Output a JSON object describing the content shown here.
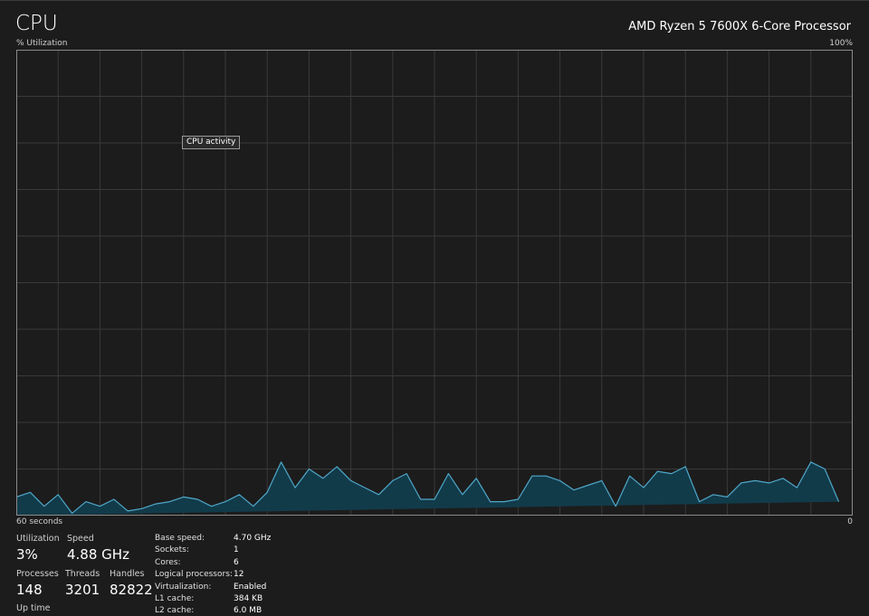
{
  "header": {
    "title": "CPU",
    "processor": "AMD Ryzen 5 7600X 6-Core Processor",
    "utilization_axis_label": "% Utilization",
    "utilization_axis_max": "100%"
  },
  "graph": {
    "time_left_label": "60 seconds",
    "time_right_label": "0",
    "tooltip": "CPU activity",
    "line_color": "#4fa7c9",
    "fill_color": "#123b4a",
    "grid_color": "#3a3a3a",
    "border_color": "#8a8a8a"
  },
  "chart_data": {
    "type": "area",
    "xlabel": "",
    "ylabel": "% Utilization",
    "ylim": [
      0,
      100
    ],
    "xlim": [
      60,
      0
    ],
    "grid": true,
    "x": [
      60,
      59,
      58,
      57,
      56,
      55,
      54,
      53,
      52,
      51,
      50,
      49,
      48,
      47,
      46,
      45,
      44,
      43,
      42,
      41,
      40,
      39,
      38,
      37,
      36,
      35,
      34,
      33,
      32,
      31,
      30,
      29,
      28,
      27,
      26,
      25,
      24,
      23,
      22,
      21,
      20,
      19,
      18,
      17,
      16,
      15,
      14,
      13,
      12,
      11,
      10,
      9,
      8,
      7,
      6,
      5,
      4,
      3,
      2,
      1,
      0
    ],
    "values": [
      4,
      5,
      2,
      4.5,
      0.5,
      3,
      2,
      3.5,
      1,
      1.5,
      2.5,
      3,
      4,
      3.5,
      2,
      3,
      4.5,
      2,
      5,
      11.5,
      6,
      10,
      8,
      10.5,
      7.5,
      6,
      4.5,
      7.5,
      9,
      3.5,
      3.5,
      9,
      4.5,
      8,
      3,
      3,
      3.5,
      8.5,
      8.5,
      7.5,
      5.5,
      6.5,
      7.5,
      2,
      8.5,
      6,
      9.5,
      9,
      10.5,
      3,
      4.5,
      4,
      7,
      7.5,
      7,
      8,
      6,
      11.5,
      10,
      3
    ]
  },
  "stats": {
    "utilization": {
      "label": "Utilization",
      "value": "3%"
    },
    "speed": {
      "label": "Speed",
      "value": "4.88 GHz"
    },
    "processes": {
      "label": "Processes",
      "value": "148"
    },
    "threads": {
      "label": "Threads",
      "value": "3201"
    },
    "handles": {
      "label": "Handles",
      "value": "82822"
    },
    "uptime": {
      "label": "Up time"
    }
  },
  "specs": [
    {
      "label": "Base speed:",
      "value": "4.70 GHz"
    },
    {
      "label": "Sockets:",
      "value": "1"
    },
    {
      "label": "Cores:",
      "value": "6"
    },
    {
      "label": "Logical processors:",
      "value": "12"
    },
    {
      "label": "Virtualization:",
      "value": "Enabled"
    },
    {
      "label": "L1 cache:",
      "value": "384 KB"
    },
    {
      "label": "L2 cache:",
      "value": "6.0 MB"
    }
  ]
}
